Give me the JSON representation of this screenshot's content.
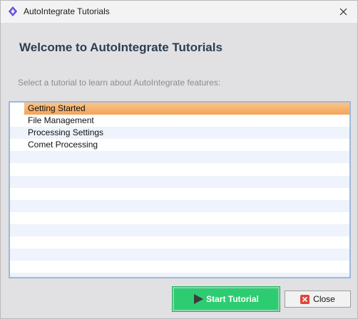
{
  "window": {
    "title": "AutoIntegrate Tutorials"
  },
  "main": {
    "heading": "Welcome to AutoIntegrate Tutorials",
    "instruction": "Select a tutorial to learn about AutoIntegrate features:"
  },
  "tutorials": {
    "selected_index": 0,
    "items": [
      {
        "label": "Getting Started"
      },
      {
        "label": "File Management"
      },
      {
        "label": "Processing Settings"
      },
      {
        "label": "Comet Processing"
      }
    ]
  },
  "buttons": {
    "start_label": "Start Tutorial",
    "close_label": "Close"
  },
  "colors": {
    "accent_green": "#2ecc71",
    "selection_orange": "#f2a45a",
    "heading_color": "#2c3e50"
  },
  "icons": {
    "app": "app-logo-icon",
    "window_close": "close-icon",
    "start": "play-icon",
    "close_button": "close-x-icon"
  }
}
